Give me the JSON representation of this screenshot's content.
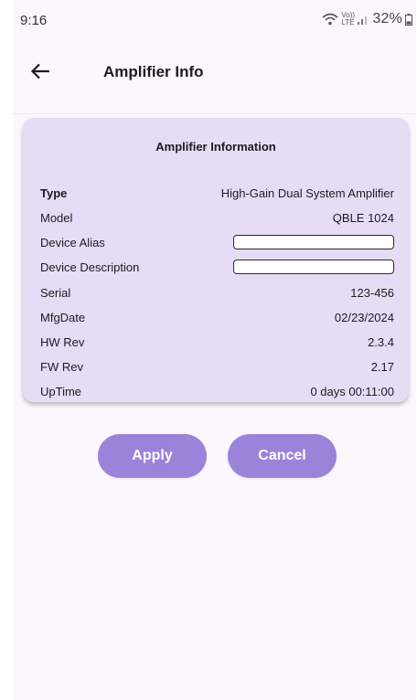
{
  "status_bar": {
    "time": "9:16",
    "network_label": "Vo)) LTE",
    "battery": "32%"
  },
  "app_bar": {
    "back_icon": "arrow-back-icon",
    "title": "Amplifier Info"
  },
  "card": {
    "title": "Amplifier Information",
    "rows": [
      {
        "label": "Type",
        "value": "High-Gain Dual System Amplifier"
      },
      {
        "label": "Model",
        "value": "QBLE 1024"
      },
      {
        "label": "Device Alias",
        "value": "",
        "placeholder": ""
      },
      {
        "label": "Device Description",
        "value": "",
        "placeholder": ""
      },
      {
        "label": "Serial",
        "value": "123-456"
      },
      {
        "label": "MfgDate",
        "value": "02/23/2024"
      },
      {
        "label": "HW Rev",
        "value": "2.3.4"
      },
      {
        "label": "FW Rev",
        "value": "2.17"
      },
      {
        "label": "UpTime",
        "value": "0 days 00:11:00"
      }
    ]
  },
  "actions": {
    "apply_label": "Apply",
    "cancel_label": "Cancel"
  },
  "colors": {
    "background": "#fcf7fc",
    "card": "#e6dcf6",
    "button": "#9b83d9"
  }
}
